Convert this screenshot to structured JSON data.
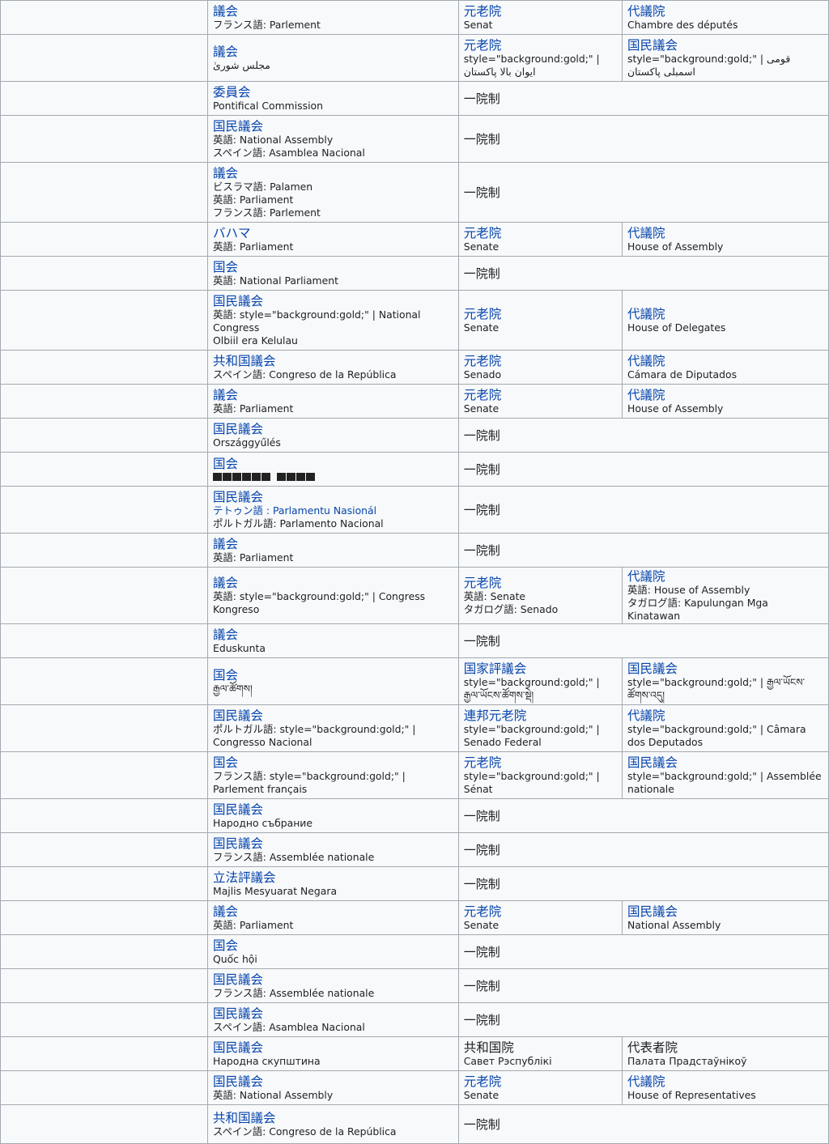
{
  "rows": [
    {
      "name": "議会",
      "subs": [
        "フランス語: Parlement"
      ],
      "upper": {
        "name": "元老院",
        "subs": [
          "Senat"
        ]
      },
      "lower": {
        "name": "代議院",
        "subs": [
          "Chambre des députés"
        ]
      }
    },
    {
      "name": "議会",
      "subs": [
        "مجلس شورىٰ"
      ],
      "upper": {
        "name": "元老院",
        "subs": [
          "style=\"background:gold;\" | ایوان بالا پاکستان"
        ]
      },
      "lower": {
        "name": "国民議会",
        "subs": [
          "style=\"background:gold;\" | قومی اسمبلی پاکستان"
        ]
      }
    },
    {
      "name": "委員会",
      "subs": [
        "Pontifical Commission"
      ],
      "uni": "一院制"
    },
    {
      "name": "国民議会",
      "subs": [
        "英語: National Assembly",
        "スペイン語: Asamblea Nacional"
      ],
      "uni": "一院制"
    },
    {
      "name": "議会",
      "subs": [
        "ビスラマ語: Palamen",
        "英語: Parliament",
        "フランス語: Parlement"
      ],
      "uni": "一院制"
    },
    {
      "name": "バハマ",
      "subs": [
        "英語: Parliament"
      ],
      "upper": {
        "name": "元老院",
        "subs": [
          "Senate"
        ]
      },
      "lower": {
        "name": "代議院",
        "subs": [
          "House of Assembly"
        ]
      }
    },
    {
      "name": "国会",
      "subs": [
        "英語: National Parliament"
      ],
      "uni": "一院制"
    },
    {
      "name": "国民議会",
      "subs": [
        "英語: style=\"background:gold;\" | National Congress",
        "Olbiil era Kelulau"
      ],
      "upper": {
        "name": "元老院",
        "subs": [
          "Senate"
        ]
      },
      "lower": {
        "name": "代議院",
        "subs": [
          "House of Delegates"
        ]
      }
    },
    {
      "name": "共和国議会",
      "subs": [
        "スペイン語: Congreso de la República"
      ],
      "upper": {
        "name": "元老院",
        "subs": [
          "Senado"
        ]
      },
      "lower": {
        "name": "代議院",
        "subs": [
          "Cámara de Diputados"
        ]
      }
    },
    {
      "name": "議会",
      "subs": [
        "英語: Parliament"
      ],
      "upper": {
        "name": "元老院",
        "subs": [
          "Senate"
        ]
      },
      "lower": {
        "name": "代議院",
        "subs": [
          "House of Assembly"
        ]
      }
    },
    {
      "name": "国民議会",
      "subs": [
        "Országgyűlés"
      ],
      "uni": "一院制"
    },
    {
      "name": "国会",
      "boxes": true,
      "uni": "一院制"
    },
    {
      "name": "国民議会",
      "subs": [
        "テトゥン語 : Parlamentu Nasionál",
        "ポルトガル語: Parlamento Nacional"
      ],
      "firstSubBlue": true,
      "uni": "一院制"
    },
    {
      "name": "議会",
      "subs": [
        "英語: Parliament"
      ],
      "uni": "一院制"
    },
    {
      "name": "議会",
      "subs": [
        "英語: style=\"background:gold;\" | Congress",
        "Kongreso"
      ],
      "upper": {
        "name": "元老院",
        "subs": [
          "英語: Senate",
          "タガログ語: Senado"
        ]
      },
      "lower": {
        "name": "代議院",
        "subs": [
          "英語: House of Assembly",
          "タガログ語: Kapulungan Mga Kinatawan"
        ]
      }
    },
    {
      "name": "議会",
      "subs": [
        "Eduskunta"
      ],
      "uni": "一院制"
    },
    {
      "name": "国会",
      "subs": [
        "རྒྱལ་ཚོགས།"
      ],
      "upper": {
        "name": "国家評議会",
        "subs": [
          "style=\"background:gold;\" | རྒྱལ་ཡོངས་ཚོགས་སྡེ།"
        ]
      },
      "lower": {
        "name": "国民議会",
        "subs": [
          "style=\"background:gold;\" | རྒྱལ་ཡོངས་ཚོགས་འདུ།"
        ]
      }
    },
    {
      "name": "国民議会",
      "subs": [
        "ポルトガル語: style=\"background:gold;\" | Congresso Nacional"
      ],
      "upper": {
        "name": "連邦元老院",
        "subs": [
          "style=\"background:gold;\" | Senado Federal"
        ]
      },
      "lower": {
        "name": "代議院",
        "subs": [
          "style=\"background:gold;\" | Câmara dos Deputados"
        ]
      }
    },
    {
      "name": "国会",
      "subs": [
        "フランス語: style=\"background:gold;\" | Parlement français"
      ],
      "upper": {
        "name": "元老院",
        "subs": [
          "style=\"background:gold;\" | Sénat"
        ]
      },
      "lower": {
        "name": "国民議会",
        "subs": [
          "style=\"background:gold;\" | Assemblée nationale"
        ]
      }
    },
    {
      "name": "国民議会",
      "subs": [
        "Народно събрание"
      ],
      "uni": "一院制"
    },
    {
      "name": "国民議会",
      "subs": [
        "フランス語: Assemblée nationale"
      ],
      "uni": "一院制"
    },
    {
      "name": "立法評議会",
      "subs": [
        "Majlis Mesyuarat Negara"
      ],
      "uni": "一院制"
    },
    {
      "name": "議会",
      "subs": [
        "英語: Parliament"
      ],
      "upper": {
        "name": "元老院",
        "subs": [
          "Senate"
        ]
      },
      "lower": {
        "name": "国民議会",
        "subs": [
          "National Assembly"
        ]
      }
    },
    {
      "name": "国会",
      "subs": [
        "Quốc hội"
      ],
      "uni": "一院制"
    },
    {
      "name": "国民議会",
      "subs": [
        "フランス語: Assemblée nationale"
      ],
      "uni": "一院制"
    },
    {
      "name": "国民議会",
      "subs": [
        "スペイン語: Asamblea Nacional"
      ],
      "uni": "一院制"
    },
    {
      "name": "国民議会",
      "subs": [
        "Народна скупштина"
      ],
      "upper": {
        "name": "共和国院",
        "subs": [
          "Савет Рэспублікі"
        ],
        "plain": true
      },
      "lower": {
        "name": "代表者院",
        "subs": [
          "Палата Прадстаўнікоў"
        ],
        "plain": true
      }
    },
    {
      "name": "国民議会",
      "subs": [
        "英語: National Assembly"
      ],
      "upper": {
        "name": "元老院",
        "subs": [
          "Senate"
        ]
      },
      "lower": {
        "name": "代議院",
        "subs": [
          "House of Representatives"
        ]
      }
    },
    {
      "name": "共和国議会",
      "subs": [
        "スペイン語: Congreso de la República"
      ],
      "uni": "一院制"
    }
  ]
}
